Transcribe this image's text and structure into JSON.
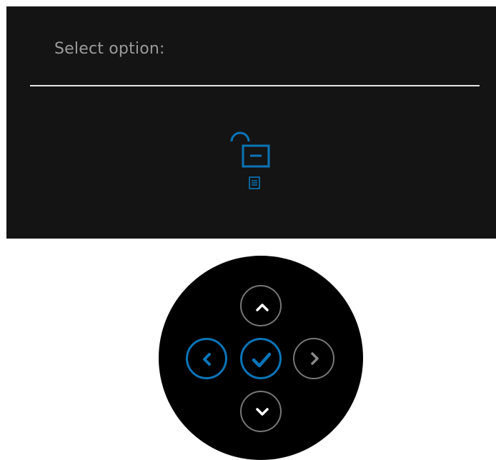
{
  "osd": {
    "title": "Select option:",
    "icons": [
      "unlock-icon",
      "menu-icon"
    ],
    "colors": {
      "background": "#141414",
      "text": "#9b9b9b",
      "divider": "#e6e6e6",
      "accent": "#0a75b8"
    }
  },
  "joystick": {
    "buttons": [
      {
        "name": "up-button",
        "icon": "chevron-up-icon",
        "state": "inactive"
      },
      {
        "name": "left-button",
        "icon": "chevron-left-icon",
        "state": "active"
      },
      {
        "name": "ok-button",
        "icon": "checkmark-icon",
        "state": "active"
      },
      {
        "name": "right-button",
        "icon": "chevron-right-icon",
        "state": "inactive"
      },
      {
        "name": "down-button",
        "icon": "chevron-down-icon",
        "state": "inactive"
      }
    ],
    "colors": {
      "active": "#0a75b8",
      "inactive": "#777777",
      "base": "#000000"
    }
  }
}
